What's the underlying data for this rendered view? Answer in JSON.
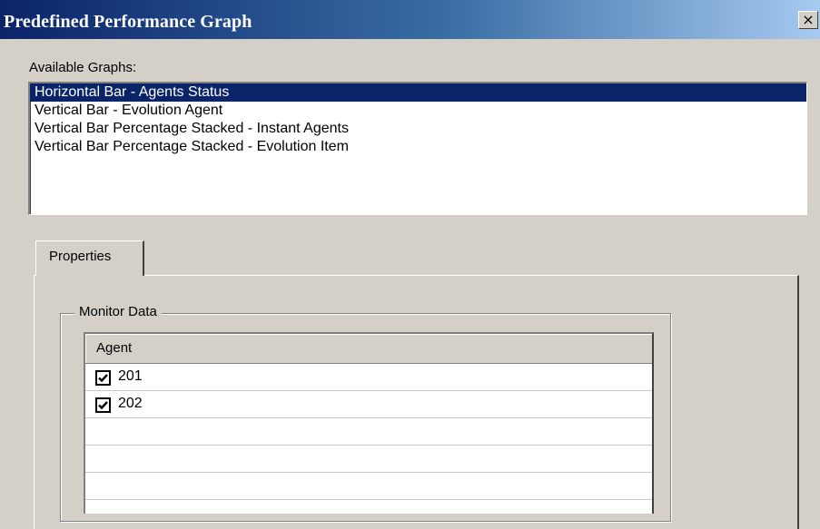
{
  "window": {
    "title": "Predefined Performance Graph",
    "close_glyph": "×"
  },
  "available_graphs": {
    "label": "Available Graphs:",
    "selected_index": 0,
    "items": [
      "Horizontal Bar - Agents Status",
      "Vertical Bar - Evolution Agent",
      "Vertical Bar Percentage Stacked - Instant Agents",
      "Vertical Bar Percentage Stacked - Evolution Item"
    ]
  },
  "tabs": [
    {
      "label": "Properties",
      "active": true
    }
  ],
  "monitor_data": {
    "title": "Monitor Data",
    "column_header": "Agent",
    "rows": [
      {
        "label": "201",
        "checked": true
      },
      {
        "label": "202",
        "checked": true
      }
    ]
  },
  "icons": {
    "close": "close-icon",
    "checkbox": "checkbox-checked-icon"
  },
  "colors": {
    "title_bar_start": "#0a246a",
    "title_bar_end": "#a6caf0",
    "selection": "#0a246a",
    "face": "#d4d0c8"
  }
}
